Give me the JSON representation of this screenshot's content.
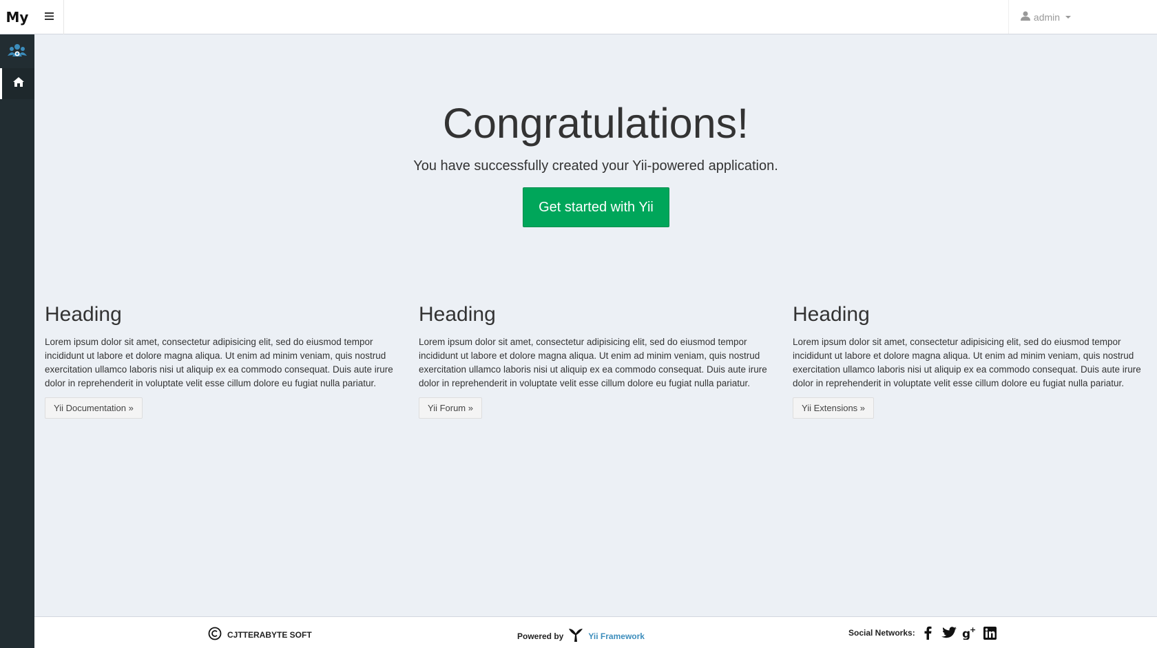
{
  "brand": {
    "logo_text": "My"
  },
  "header": {
    "user_name": "admin"
  },
  "jumbotron": {
    "title": "Congratulations!",
    "lead": "You have successfully created your Yii-powered application.",
    "button_label": "Get started with Yii"
  },
  "columns": [
    {
      "heading": "Heading",
      "body": "Lorem ipsum dolor sit amet, consectetur adipisicing elit, sed do eiusmod tempor incididunt ut labore et dolore magna aliqua. Ut enim ad minim veniam, quis nostrud exercitation ullamco laboris nisi ut aliquip ex ea commodo consequat. Duis aute irure dolor in reprehenderit in voluptate velit esse cillum dolore eu fugiat nulla pariatur.",
      "button_label": "Yii Documentation »"
    },
    {
      "heading": "Heading",
      "body": "Lorem ipsum dolor sit amet, consectetur adipisicing elit, sed do eiusmod tempor incididunt ut labore et dolore magna aliqua. Ut enim ad minim veniam, quis nostrud exercitation ullamco laboris nisi ut aliquip ex ea commodo consequat. Duis aute irure dolor in reprehenderit in voluptate velit esse cillum dolore eu fugiat nulla pariatur.",
      "button_label": "Yii Forum »"
    },
    {
      "heading": "Heading",
      "body": "Lorem ipsum dolor sit amet, consectetur adipisicing elit, sed do eiusmod tempor incididunt ut labore et dolore magna aliqua. Ut enim ad minim veniam, quis nostrud exercitation ullamco laboris nisi ut aliquip ex ea commodo consequat. Duis aute irure dolor in reprehenderit in voluptate velit esse cillum dolore eu fugiat nulla pariatur.",
      "button_label": "Yii Extensions »"
    }
  ],
  "footer": {
    "copyright_text": "CJTTERABYTE SOFT",
    "powered_label": "Powered by",
    "framework_link": "Yii Framework",
    "social_label": "Social Networks:"
  },
  "icons": {
    "sidebar": [
      "users-icon",
      "home-icon"
    ],
    "header": [
      "menu-icon",
      "user-icon",
      "caret-down-icon"
    ],
    "footer": [
      "copyright-icon",
      "yii-logo-icon",
      "facebook-icon",
      "twitter-icon",
      "google-plus-icon",
      "linkedin-icon"
    ]
  },
  "colors": {
    "sidebar_bg": "#222d32",
    "content_bg": "#ecf0f5",
    "primary_button": "#00a65a",
    "link": "#3c8dbc"
  }
}
